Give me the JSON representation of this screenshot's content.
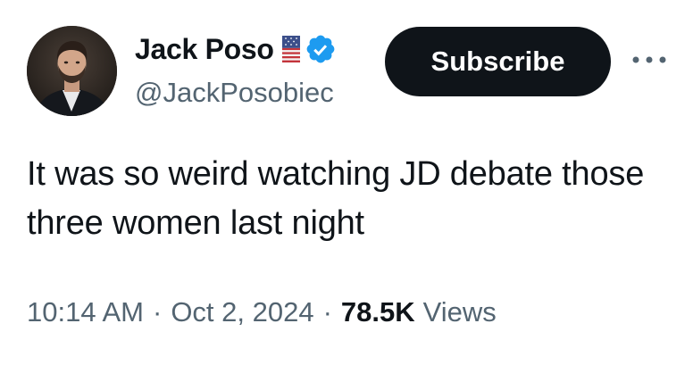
{
  "author": {
    "display_name": "Jack Poso",
    "handle": "@JackPosobiec",
    "badges": [
      "us-flag-icon",
      "verified-badge-icon"
    ],
    "avatar": "profile-photo"
  },
  "actions": {
    "subscribe_label": "Subscribe",
    "more_icon": "more-horizontal-icon"
  },
  "tweet": {
    "text": "It was so weird watching JD debate those three women last night"
  },
  "meta": {
    "time": "10:14 AM",
    "separator": "·",
    "date": "Oct 2, 2024",
    "views_count": "78.5K",
    "views_label": "Views"
  },
  "colors": {
    "text_primary": "#0f1419",
    "text_secondary": "#536471",
    "verified_blue": "#1d9bf0",
    "button_bg": "#0f1419",
    "button_text": "#ffffff"
  }
}
